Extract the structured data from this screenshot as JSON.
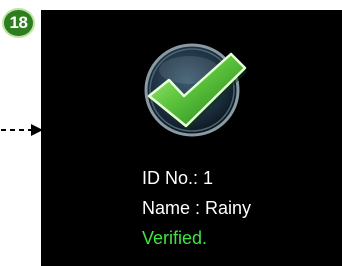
{
  "step_badge": {
    "number": "18"
  },
  "icons": {
    "arrow": "dashed-right-arrow-icon",
    "check": "green-checkmark-icon"
  },
  "result": {
    "id_line": "ID No.: 1",
    "name_line": "Name : Rainy",
    "status_line": "Verified."
  },
  "colors": {
    "screen_background": "#000000",
    "text": "#ffffff",
    "status": "#3fe53f",
    "badge": "#2e7d1e",
    "check": "#5cc43c"
  }
}
